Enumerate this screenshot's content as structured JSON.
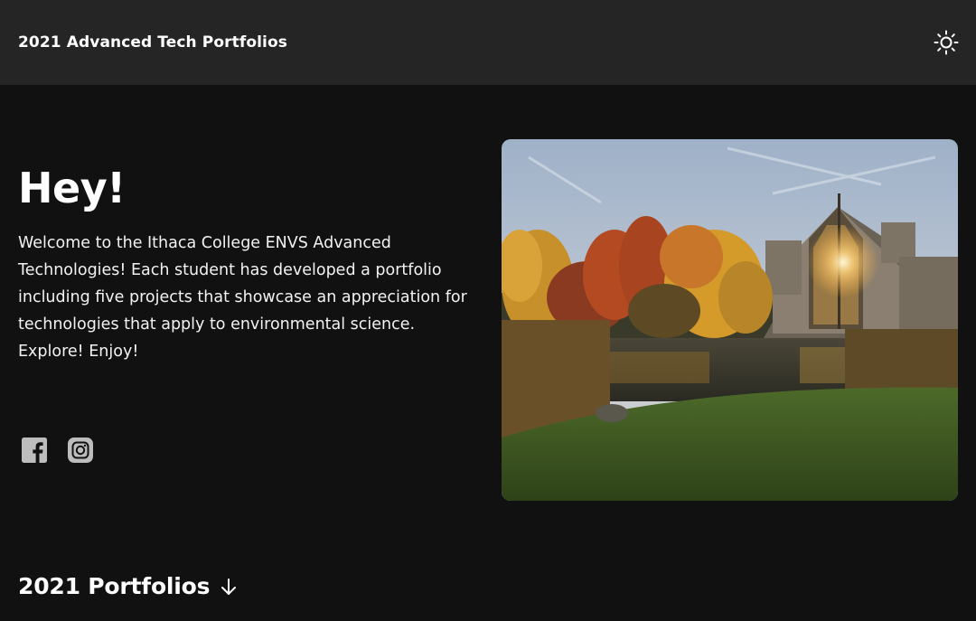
{
  "header": {
    "title": "2021 Advanced Tech Portfolios",
    "theme_icon": "sun-icon"
  },
  "hero": {
    "heading": "Hey!",
    "body": "Welcome to the Ithaca College ENVS Advanced Technologies! Each student has developed a portfolio including five projects that showcase an appreciation for technologies that apply to environmental science. Explore! Enjoy!",
    "social_icons": [
      "facebook-icon",
      "instagram-icon"
    ],
    "image": "campus-building-autumn-pond-photo"
  },
  "portfolios": {
    "heading": "2021 Portfolios",
    "icon": "arrow-down-icon"
  },
  "colors": {
    "background": "#111111",
    "header_background": "#252525",
    "text": "#ffffff",
    "icon_gray": "#bdbdbd"
  }
}
